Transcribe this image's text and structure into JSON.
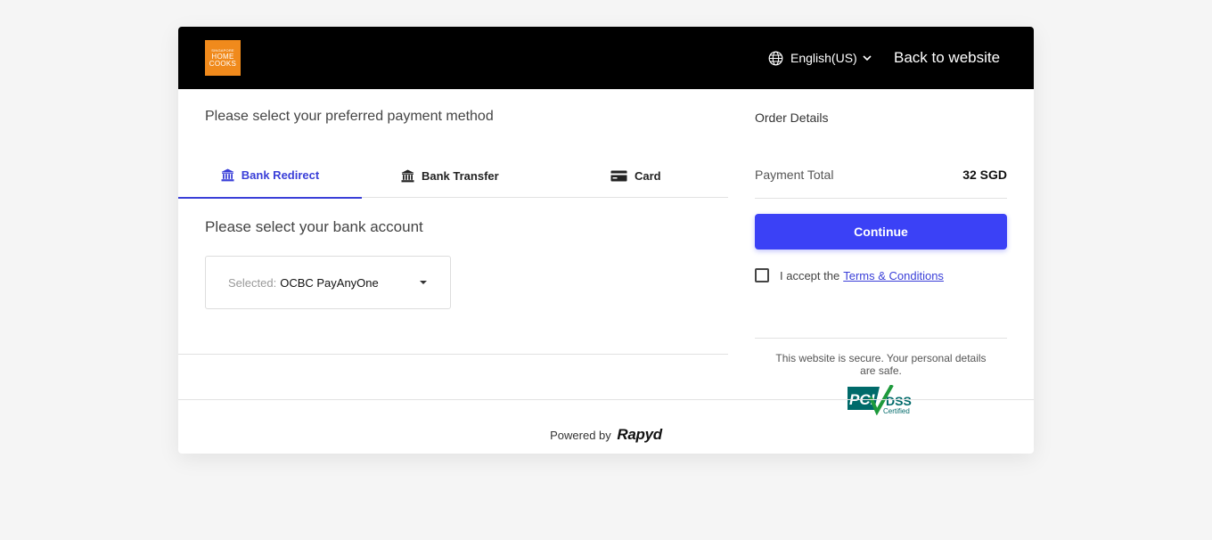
{
  "header": {
    "logo": {
      "line1": "SINGAPORE",
      "line2": "HOME",
      "line3": "COOKS"
    },
    "language": "English(US)",
    "back_link": "Back to website"
  },
  "payment": {
    "title": "Please select your preferred payment method",
    "tabs": [
      {
        "label": "Bank Redirect",
        "icon": "bank-icon",
        "active": true
      },
      {
        "label": "Bank Transfer",
        "icon": "bank-icon",
        "active": false
      },
      {
        "label": "Card",
        "icon": "card-icon",
        "active": false
      }
    ],
    "bank_title": "Please select your bank account",
    "select": {
      "label": "Selected:",
      "value": "OCBC PayAnyOne"
    }
  },
  "order": {
    "title": "Order Details",
    "total_label": "Payment Total",
    "total_value": "32 SGD",
    "continue_label": "Continue",
    "accept_prefix": "I accept the",
    "terms_link": "Terms & Conditions",
    "secure_text": "This website is secure. Your personal details are safe.",
    "pci_badge": {
      "left": "PCI",
      "right": "DSS",
      "sub": "Certified"
    }
  },
  "footer": {
    "powered_prefix": "Powered by",
    "brand": "Rapyd"
  },
  "colors": {
    "accent": "#3b41f6",
    "header_bg": "#000000",
    "logo_bg": "#f08a1c",
    "tab_active": "#3a3fd8"
  }
}
